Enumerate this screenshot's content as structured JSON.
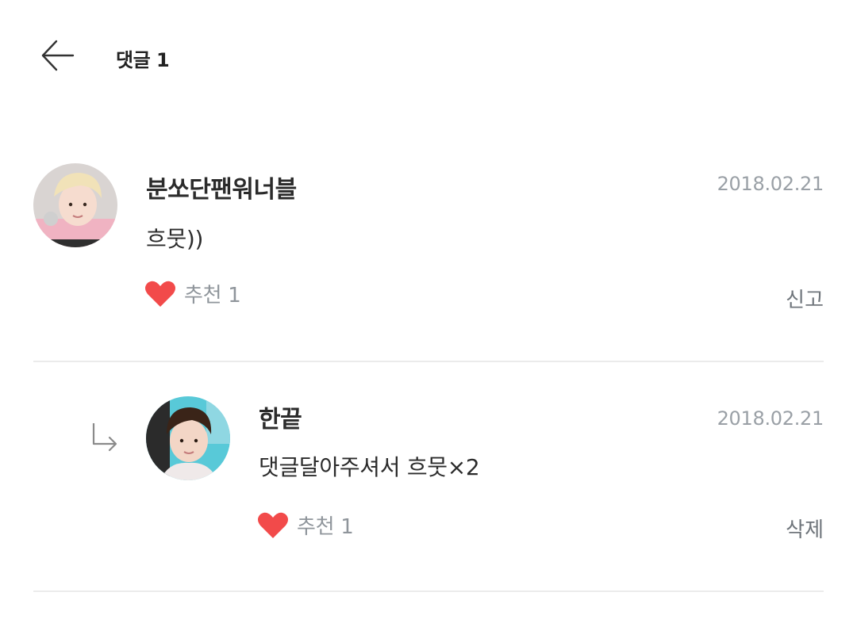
{
  "header": {
    "title": "댓글 1",
    "back_icon": "arrow-left-icon"
  },
  "comments": [
    {
      "author": "분쏘단팬워너블",
      "date": "2018.02.21",
      "text": "흐뭇))",
      "like_label": "추천 1",
      "action_label": "신고",
      "avatar_icon": "user-avatar",
      "like_icon": "heart-icon"
    }
  ],
  "replies": [
    {
      "author": "한끝",
      "date": "2018.02.21",
      "text": "댓글달아주셔서 흐뭇×2",
      "like_label": "추천 1",
      "action_label": "삭제",
      "avatar_icon": "user-avatar",
      "like_icon": "heart-icon",
      "reply_icon": "reply-arrow-icon"
    }
  ],
  "colors": {
    "heart": "#f24a4a",
    "date": "#9aa0a6",
    "divider": "#ebebeb",
    "text": "#2b2b2b"
  }
}
